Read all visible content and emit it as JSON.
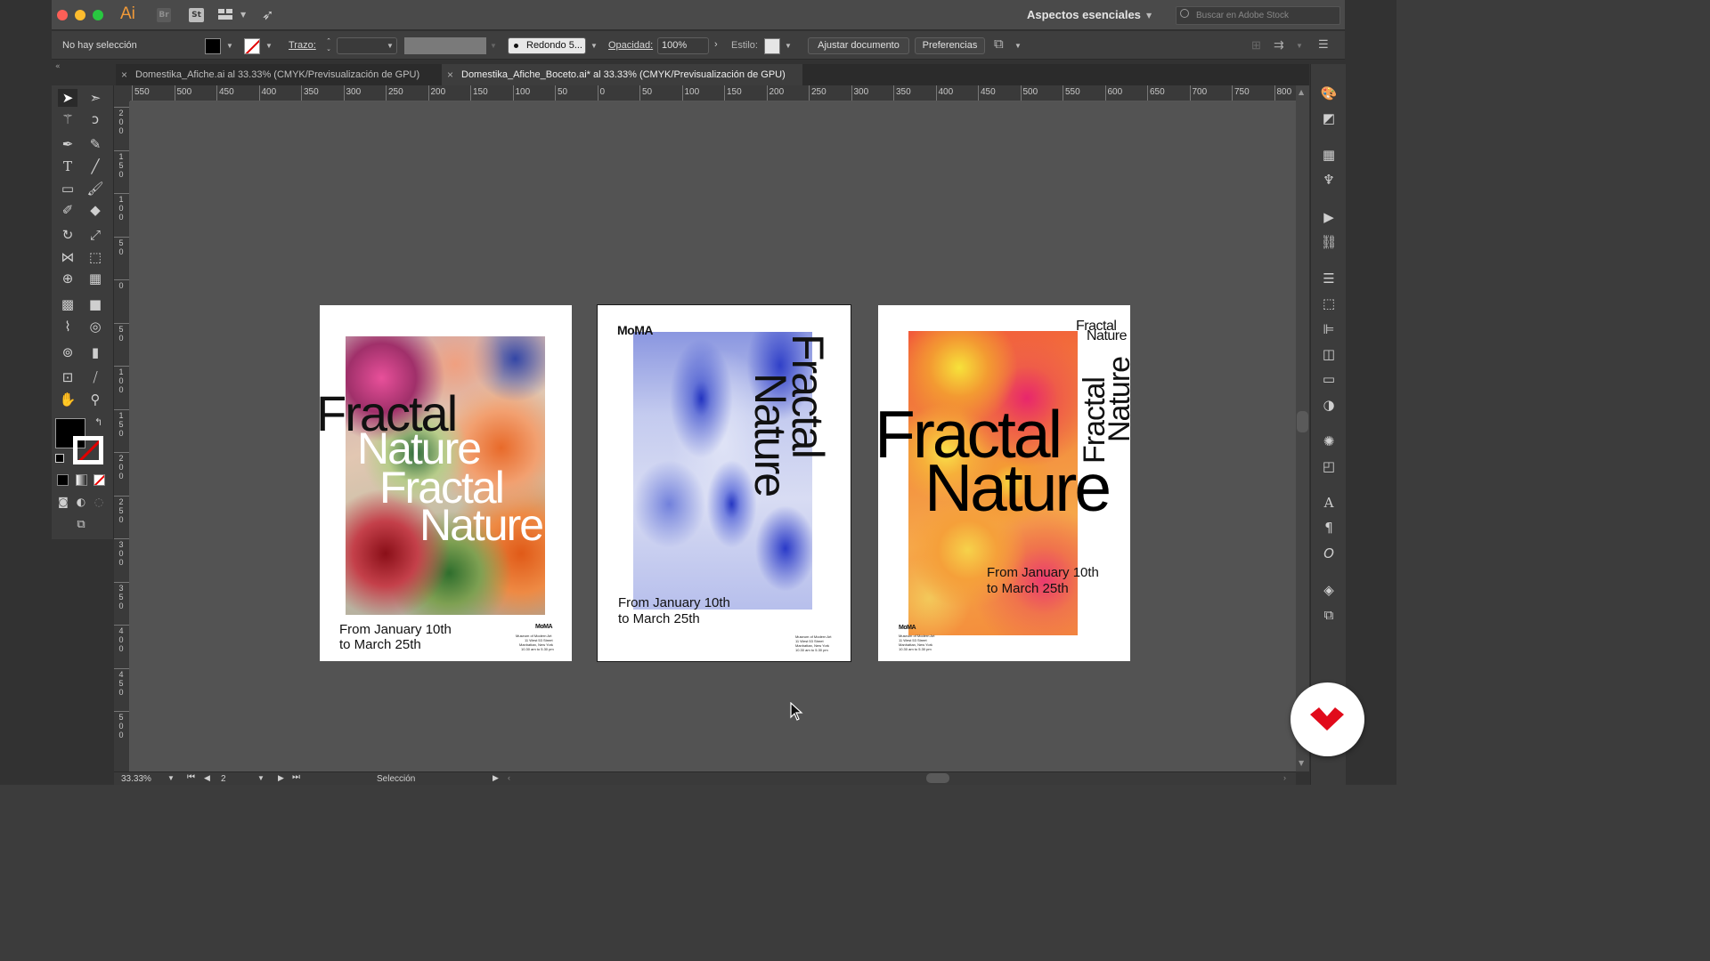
{
  "app": {
    "logo": "Ai",
    "bridge": "Br",
    "stock": "St"
  },
  "workspace": {
    "label": "Aspectos esenciales",
    "search_placeholder": "Buscar en Adobe Stock"
  },
  "control_bar": {
    "selection_label": "No hay selección",
    "stroke_label": "Trazo:",
    "brush_label": "Redondo 5...",
    "opacity_label": "Opacidad:",
    "opacity_value": "100%",
    "style_label": "Estilo:",
    "fit_document_button": "Ajustar documento",
    "preferences_button": "Preferencias"
  },
  "tabs": [
    {
      "label": "Domestika_Afiche.ai al 33.33% (CMYK/Previsualización de GPU)",
      "active": false
    },
    {
      "label": "Domestika_Afiche_Boceto.ai* al 33.33% (CMYK/Previsualización de GPU)",
      "active": true
    }
  ],
  "ruler": {
    "h_labels": [
      "550",
      "500",
      "450",
      "400",
      "350",
      "300",
      "250",
      "200",
      "150",
      "100",
      "50",
      "0",
      "50",
      "100",
      "150",
      "200",
      "250",
      "300",
      "350",
      "400",
      "450",
      "500",
      "550",
      "600",
      "650",
      "700",
      "750",
      "800"
    ],
    "v_labels": [
      "200",
      "150",
      "100",
      "50",
      "0",
      "50",
      "100",
      "150",
      "200",
      "250",
      "300",
      "350",
      "400",
      "450",
      "500"
    ]
  },
  "posters": {
    "poster1": {
      "title_lines": [
        "Fractal",
        "Nature",
        "Fractal",
        "Nature"
      ],
      "dates": [
        "From January 10th",
        "to March 25th"
      ],
      "logo": "MoMA",
      "address": [
        "Museum of Modern Art",
        "11 West 53 Street",
        "Manhattan, New York",
        "10.30 am to 5.30 pm"
      ]
    },
    "poster2": {
      "logo": "MoMA",
      "title_lines": [
        "Fractal",
        "Nature"
      ],
      "dates": [
        "From January 10th",
        "to March 25th"
      ],
      "address": [
        "Museum of Modern Art",
        "11 West 53 Street",
        "Manhattan, New York",
        "10.30 am to 5.30 pm"
      ]
    },
    "poster3": {
      "corner_lines": [
        "Fractal",
        "Nature"
      ],
      "vertical_lines": [
        "Fractal",
        "Nature"
      ],
      "title_lines": [
        "Fractal",
        "Nature"
      ],
      "dates": [
        "From January 10th",
        "to March 25th"
      ],
      "logo": "MoMA",
      "address": [
        "Museum of Modern Art",
        "11 West 53 Street",
        "Manhattan, New York",
        "10.30 am to 5.30 pm"
      ]
    }
  },
  "status_bar": {
    "zoom": "33.33%",
    "artboard_number": "2",
    "tool_label": "Selección"
  },
  "colors": {
    "accent_orange": "#f29a38",
    "domestika_red": "#e10b1b"
  }
}
